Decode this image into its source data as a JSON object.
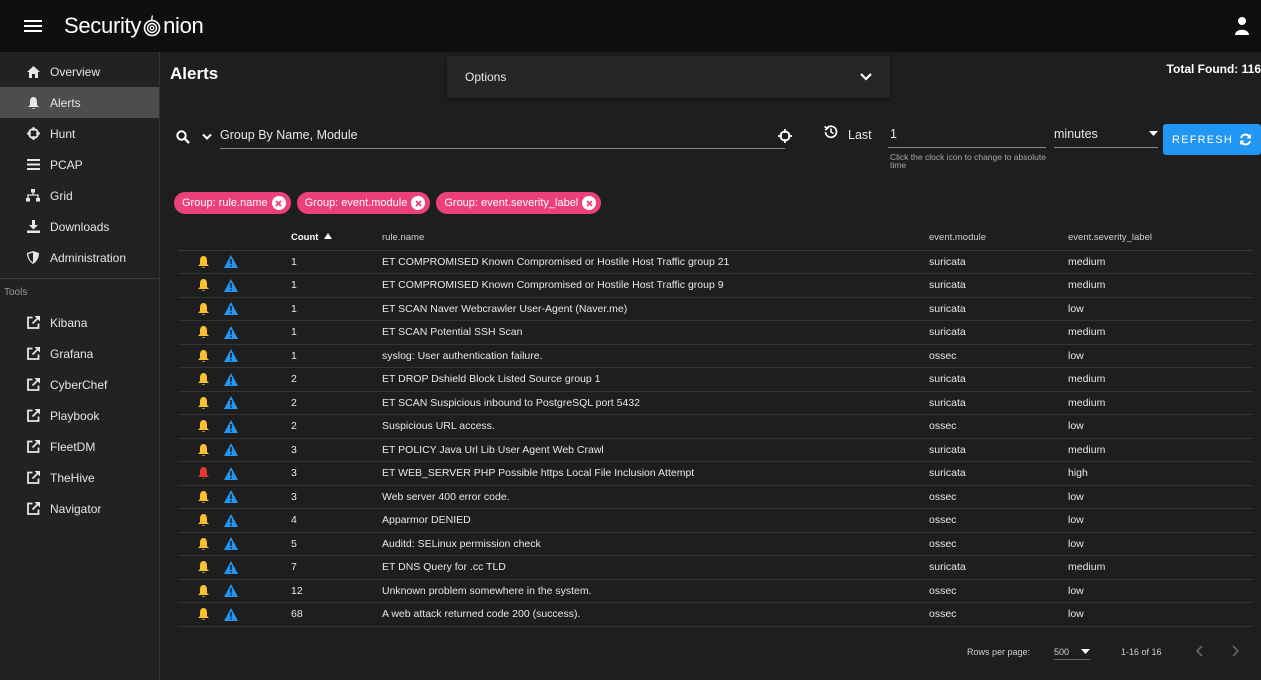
{
  "app": {
    "brand_prefix": "Security",
    "brand_suffix": "nion"
  },
  "sidebar": {
    "items": [
      {
        "label": "Overview",
        "icon": "home-icon"
      },
      {
        "label": "Alerts",
        "icon": "bell-icon",
        "active": true
      },
      {
        "label": "Hunt",
        "icon": "crosshair-icon"
      },
      {
        "label": "PCAP",
        "icon": "list-icon"
      },
      {
        "label": "Grid",
        "icon": "sitemap-icon"
      },
      {
        "label": "Downloads",
        "icon": "download-icon"
      },
      {
        "label": "Administration",
        "icon": "shield-icon"
      }
    ],
    "tools_label": "Tools",
    "tools": [
      {
        "label": "Kibana",
        "icon": "external-link-icon"
      },
      {
        "label": "Grafana",
        "icon": "external-link-icon"
      },
      {
        "label": "CyberChef",
        "icon": "external-link-icon"
      },
      {
        "label": "Playbook",
        "icon": "external-link-icon"
      },
      {
        "label": "FleetDM",
        "icon": "external-link-icon"
      },
      {
        "label": "TheHive",
        "icon": "external-link-icon"
      },
      {
        "label": "Navigator",
        "icon": "external-link-icon"
      }
    ]
  },
  "main": {
    "title": "Alerts",
    "options_label": "Options",
    "total_found": "Total Found: 116"
  },
  "search": {
    "query": "Group By Name, Module",
    "last_label": "Last",
    "last_value": "1",
    "hint": "Click the clock icon to change to absolute time",
    "unit": "minutes",
    "refresh_label": "REFRESH"
  },
  "chips": [
    "Group: rule.name",
    "Group: event.module",
    "Group: event.severity_label"
  ],
  "table": {
    "headers": {
      "count": "Count",
      "rule": "rule.name",
      "module": "event.module",
      "severity": "event.severity_label"
    },
    "rows": [
      {
        "count": "1",
        "rule": "ET COMPROMISED Known Compromised or Hostile Host Traffic group 21",
        "module": "suricata",
        "severity": "medium",
        "bell": "#fbc02d"
      },
      {
        "count": "1",
        "rule": "ET COMPROMISED Known Compromised or Hostile Host Traffic group 9",
        "module": "suricata",
        "severity": "medium",
        "bell": "#fbc02d"
      },
      {
        "count": "1",
        "rule": "ET SCAN Naver Webcrawler User-Agent (Naver.me)",
        "module": "suricata",
        "severity": "low",
        "bell": "#fbc02d"
      },
      {
        "count": "1",
        "rule": "ET SCAN Potential SSH Scan",
        "module": "suricata",
        "severity": "medium",
        "bell": "#fbc02d"
      },
      {
        "count": "1",
        "rule": "syslog: User authentication failure.",
        "module": "ossec",
        "severity": "low",
        "bell": "#fbc02d"
      },
      {
        "count": "2",
        "rule": "ET DROP Dshield Block Listed Source group 1",
        "module": "suricata",
        "severity": "medium",
        "bell": "#fbc02d"
      },
      {
        "count": "2",
        "rule": "ET SCAN Suspicious inbound to PostgreSQL port 5432",
        "module": "suricata",
        "severity": "medium",
        "bell": "#fbc02d"
      },
      {
        "count": "2",
        "rule": "Suspicious URL access.",
        "module": "ossec",
        "severity": "low",
        "bell": "#fbc02d"
      },
      {
        "count": "3",
        "rule": "ET POLICY Java Url Lib User Agent Web Crawl",
        "module": "suricata",
        "severity": "medium",
        "bell": "#fbc02d"
      },
      {
        "count": "3",
        "rule": "ET WEB_SERVER PHP Possible https Local File Inclusion Attempt",
        "module": "suricata",
        "severity": "high",
        "bell": "#e53935"
      },
      {
        "count": "3",
        "rule": "Web server 400 error code.",
        "module": "ossec",
        "severity": "low",
        "bell": "#fbc02d"
      },
      {
        "count": "4",
        "rule": "Apparmor DENIED",
        "module": "ossec",
        "severity": "low",
        "bell": "#fbc02d"
      },
      {
        "count": "5",
        "rule": "Auditd: SELinux permission check",
        "module": "ossec",
        "severity": "low",
        "bell": "#fbc02d"
      },
      {
        "count": "7",
        "rule": "ET DNS Query for .cc TLD",
        "module": "suricata",
        "severity": "medium",
        "bell": "#fbc02d"
      },
      {
        "count": "12",
        "rule": "Unknown problem somewhere in the system.",
        "module": "ossec",
        "severity": "low",
        "bell": "#fbc02d"
      },
      {
        "count": "68",
        "rule": "A web attack returned code 200 (success).",
        "module": "ossec",
        "severity": "low",
        "bell": "#fbc02d"
      }
    ]
  },
  "footer": {
    "rows_per_page_label": "Rows per page:",
    "rows_per_page": "500",
    "page_range": "1-16 of 16"
  },
  "colors": {
    "accent": "#2196f3",
    "chip": "#ec407a",
    "medium_bell": "#fbc02d",
    "high_bell": "#e53935",
    "ack": "#2196f3"
  }
}
